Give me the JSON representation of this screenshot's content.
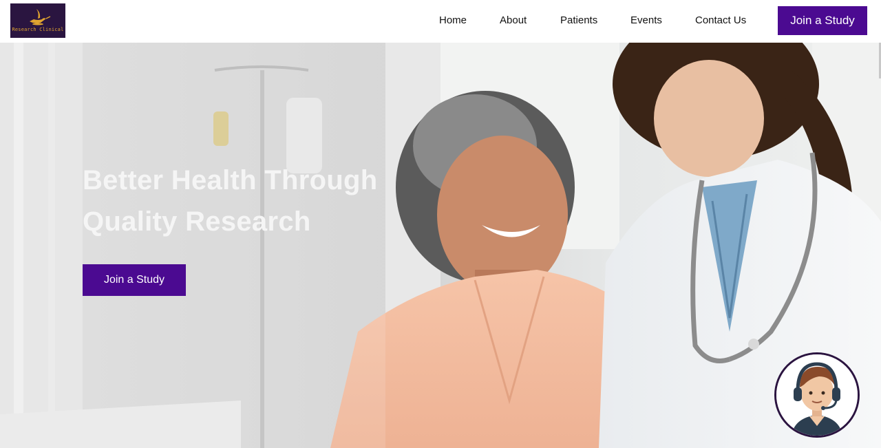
{
  "brand": {
    "logo_text": "Research Clinical",
    "logo_icon": "genie-lamp-icon",
    "accent_color": "#4b0a91"
  },
  "nav": {
    "items": [
      {
        "label": "Home"
      },
      {
        "label": "About"
      },
      {
        "label": "Patients"
      },
      {
        "label": "Events"
      },
      {
        "label": "Contact Us"
      }
    ],
    "cta_label": "Join a Study"
  },
  "hero": {
    "title_line1": "Better Health Through",
    "title_line2": "Quality Research",
    "cta_label": "Join a Study",
    "image": "smiling-patient-with-doctor-photo"
  },
  "chat": {
    "icon": "support-agent-headset-icon"
  }
}
